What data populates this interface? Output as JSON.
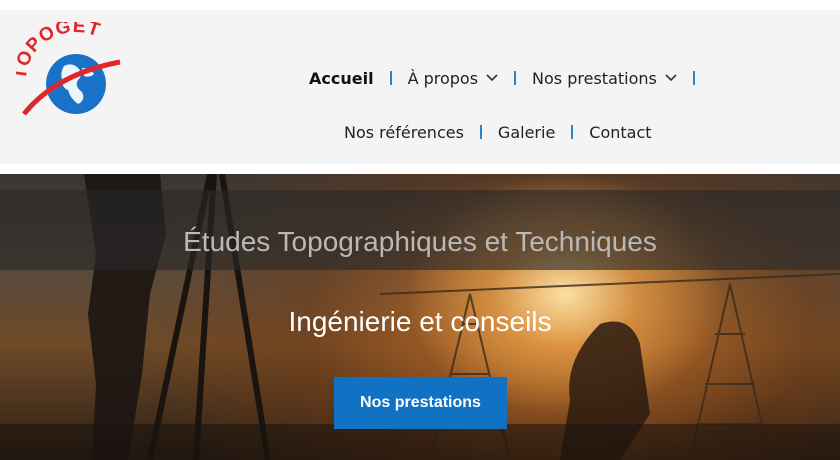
{
  "logo": {
    "text": "TOPOGET",
    "icon": "globe-icon"
  },
  "nav": {
    "row1": [
      {
        "label": "Accueil",
        "active": true,
        "dropdown": false
      },
      {
        "label": "À propos",
        "active": false,
        "dropdown": true
      },
      {
        "label": "Nos prestations",
        "active": false,
        "dropdown": true
      }
    ],
    "row2": [
      {
        "label": "Nos références"
      },
      {
        "label": "Galerie"
      },
      {
        "label": "Contact"
      }
    ]
  },
  "hero": {
    "title": "Études Topographiques et Techniques",
    "subtitle": "Ingénierie et conseils",
    "cta_label": "Nos prestations"
  },
  "colors": {
    "accent": "#1172c4",
    "separator": "#2a84c8",
    "logo_red": "#e0262b",
    "logo_blue": "#1a73c9",
    "header_bg": "#f4f4f4"
  }
}
